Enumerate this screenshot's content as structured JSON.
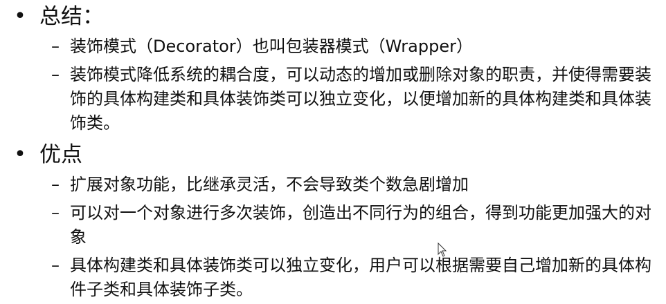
{
  "slide": {
    "sections": [
      {
        "bullet": "•",
        "heading": "总结：",
        "items": [
          {
            "dash": "–",
            "text": "装饰模式（Decorator）也叫包装器模式（Wrapper）"
          },
          {
            "dash": "–",
            "text": "装饰模式降低系统的耦合度，可以动态的增加或删除对象的职责，并使得需要装饰的具体构建类和具体装饰类可以独立变化，以便增加新的具体构建类和具体装饰类。"
          }
        ]
      },
      {
        "bullet": "•",
        "heading": "优点",
        "items": [
          {
            "dash": "–",
            "text": "扩展对象功能，比继承灵活，不会导致类个数急剧增加"
          },
          {
            "dash": "–",
            "text": "可以对一个对象进行多次装饰，创造出不同行为的组合，得到功能更加强大的对象"
          },
          {
            "dash": "–",
            "text": "具体构建类和具体装饰类可以独立变化，用户可以根据需要自己增加新的具体构件子类和具体装饰子类。"
          }
        ]
      }
    ]
  },
  "cursor": {
    "icon": "mouse-pointer-icon"
  }
}
